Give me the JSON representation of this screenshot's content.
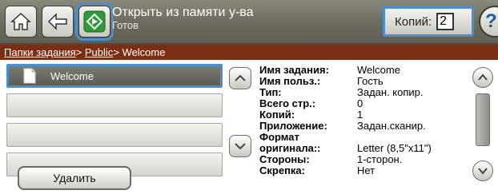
{
  "header": {
    "title": "Открыть из памяти у-ва",
    "status": "Готов",
    "copies_label": "Копий:",
    "copies_value": "2",
    "help_label": "?",
    "icons": [
      "home-icon",
      "back-icon",
      "start-icon",
      "help-icon"
    ]
  },
  "breadcrumb": {
    "items": [
      "Папки задания",
      "Public",
      "Welcome"
    ],
    "separator": ">"
  },
  "job_list": {
    "items": [
      "Welcome",
      "",
      "",
      "",
      ""
    ],
    "selected_index": 0
  },
  "delete_label": "Удалить",
  "details": {
    "rows": [
      {
        "label": "Имя задания:",
        "value": "Welcome"
      },
      {
        "label": "Имя польз.:",
        "value": "Гость"
      },
      {
        "label": "Тип:",
        "value": "Задан. копир."
      },
      {
        "label": "Всего стр.:",
        "value": "0"
      },
      {
        "label": "Копий:",
        "value": "1"
      },
      {
        "label": "Приложение:",
        "value": "Задан.сканир."
      },
      {
        "label": "Формат",
        "value": ""
      },
      {
        "label": "оригинала::",
        "value": "Letter (8,5\"x11\")"
      },
      {
        "label": "Стороны:",
        "value": "1-сторон."
      },
      {
        "label": "Скрепка:",
        "value": "Нет"
      }
    ]
  },
  "colors": {
    "header": "#6f6f63",
    "breadcrumb": "#7a2e14",
    "selection": "#4a8fd0",
    "start_button": "#2f9a3a"
  }
}
